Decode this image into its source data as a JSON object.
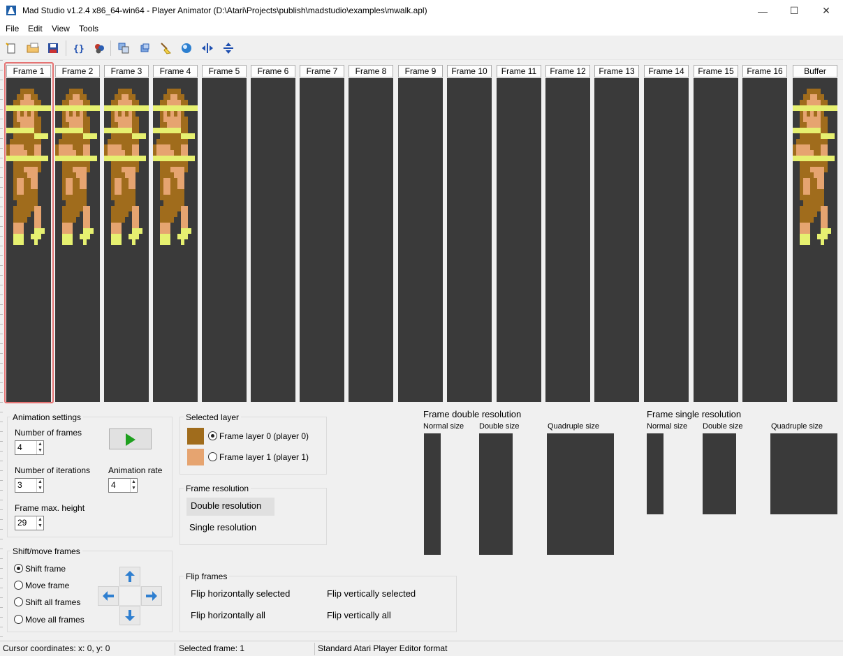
{
  "window": {
    "title": "Mad Studio  v1.2.4 x86_64-win64 - Player Animator (D:\\Atari\\Projects\\publish\\madstudio\\examples\\mwalk.apl)",
    "minimize_glyph": "—",
    "maximize_glyph": "☐",
    "close_glyph": "✕"
  },
  "menu": {
    "file": "File",
    "edit": "Edit",
    "view": "View",
    "tools": "Tools"
  },
  "frames": {
    "labels": [
      "Frame 1",
      "Frame 2",
      "Frame 3",
      "Frame 4",
      "Frame 5",
      "Frame 6",
      "Frame 7",
      "Frame 8",
      "Frame 9",
      "Frame 10",
      "Frame 11",
      "Frame 12",
      "Frame 13",
      "Frame 14",
      "Frame 15",
      "Frame 16"
    ],
    "buffer_label": "Buffer",
    "selected_index": 1
  },
  "colors": {
    "player0": "#a06c1c",
    "player1": "#e6a470",
    "overlap": "#e6f070",
    "canvas": "#3a3a3a",
    "highlight": "#e57373"
  },
  "animation": {
    "title": "Animation settings",
    "num_frames_label": "Number of frames",
    "num_frames": "4",
    "iterations_label": "Number of iterations",
    "iterations": "3",
    "rate_label": "Animation rate",
    "rate": "4",
    "max_height_label": "Frame max. height",
    "max_height": "29",
    "play_icon": "play-icon"
  },
  "layer": {
    "title": "Selected layer",
    "layer0": "Frame layer 0 (player 0)",
    "layer1": "Frame layer 1 (player 1)"
  },
  "resolution": {
    "title": "Frame resolution",
    "double": "Double resolution",
    "single": "Single resolution"
  },
  "preview_double": {
    "title": "Frame double resolution",
    "normal": "Normal size",
    "double": "Double size",
    "quad": "Quadruple size"
  },
  "preview_single": {
    "title": "Frame single resolution",
    "normal": "Normal size",
    "double": "Double size",
    "quad": "Quadruple size"
  },
  "shift": {
    "title": "Shift/move frames",
    "shift_frame": "Shift frame",
    "move_frame": "Move frame",
    "shift_all": "Shift all frames",
    "move_all": "Move all frames"
  },
  "flip": {
    "title": "Flip frames",
    "h_selected": "Flip horizontally selected",
    "v_selected": "Flip vertically selected",
    "h_all": "Flip horizontally all",
    "v_all": "Flip vertically all"
  },
  "status": {
    "cursor": "Cursor coordinates: x: 0, y: 0",
    "selected": "Selected frame: 1",
    "format": "Standard Atari Player Editor format"
  }
}
